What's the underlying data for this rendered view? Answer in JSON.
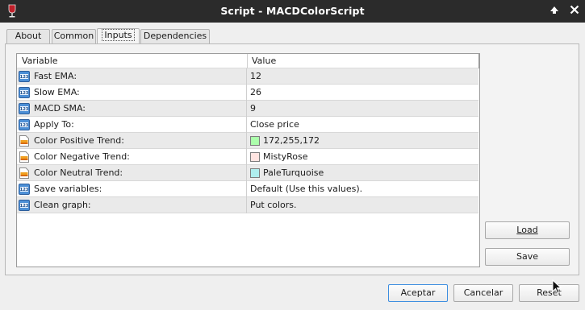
{
  "window": {
    "title": "Script - MACDColorScript",
    "icons": [
      "app-wine-glass-icon",
      "caret-up-icon",
      "close-icon"
    ]
  },
  "tabs": [
    {
      "label": "About",
      "active": false
    },
    {
      "label": "Common",
      "active": false
    },
    {
      "label": "Inputs",
      "active": true
    },
    {
      "label": "Dependencies",
      "active": false
    }
  ],
  "grid": {
    "headers": {
      "variable": "Variable",
      "value": "Value"
    },
    "rows": [
      {
        "icon": "numeric-123-icon",
        "name": "Fast EMA:",
        "value": "12"
      },
      {
        "icon": "numeric-123-icon",
        "name": "Slow EMA:",
        "value": "26"
      },
      {
        "icon": "numeric-123-icon",
        "name": "MACD SMA:",
        "value": "9"
      },
      {
        "icon": "numeric-123-icon",
        "name": "Apply To:",
        "value": "Close price"
      },
      {
        "icon": "color-document-icon",
        "name": "Color Positive Trend:",
        "value": "172,255,172",
        "color": "#acffac"
      },
      {
        "icon": "color-document-icon",
        "name": "Color Negative Trend:",
        "value": "MistyRose",
        "color": "#ffe4e1"
      },
      {
        "icon": "color-document-icon",
        "name": "Color Neutral Trend:",
        "value": "PaleTurquoise",
        "color": "#afeeee"
      },
      {
        "icon": "numeric-123-icon",
        "name": "Save variables:",
        "value": "Default (Use this values)."
      },
      {
        "icon": "numeric-123-icon",
        "name": "Clean graph:",
        "value": "Put colors."
      }
    ]
  },
  "side_buttons": {
    "load": "Load",
    "save": "Save"
  },
  "footer_buttons": {
    "accept": "Aceptar",
    "cancel": "Cancelar",
    "reset": "Reset"
  },
  "colors": {
    "titlebar": "#2b2b2b",
    "focus_border": "#3d8ee0"
  }
}
